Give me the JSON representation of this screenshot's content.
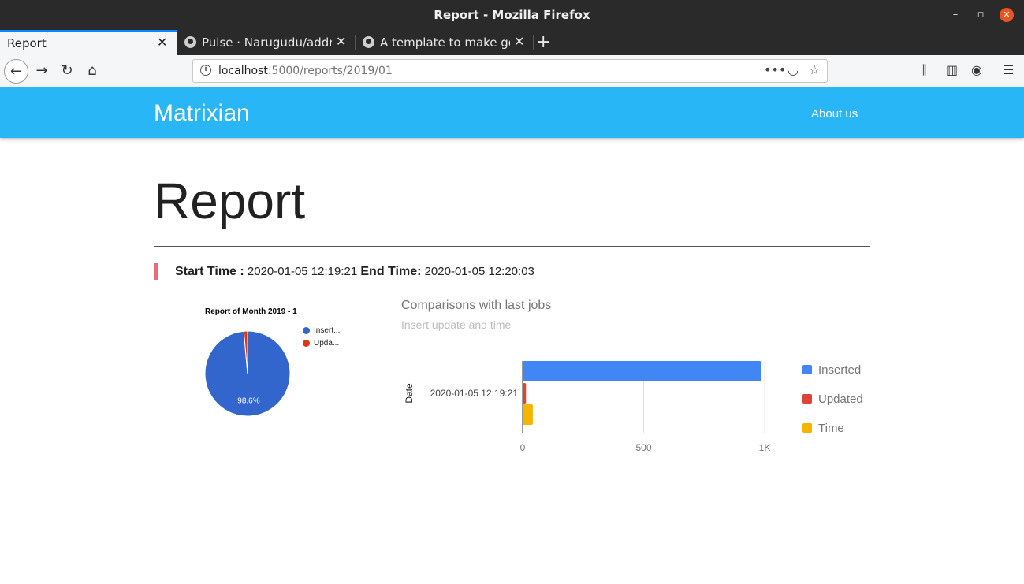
{
  "window": {
    "title": "Report - Mozilla Firefox"
  },
  "tabs": [
    {
      "label": "Report",
      "active": true
    },
    {
      "label": "Pulse · Narugudu/address",
      "icon": "github-icon"
    },
    {
      "label": "A template to make good",
      "icon": "github-icon"
    }
  ],
  "navigation": {
    "url_host": "localhost",
    "url_path": ":5000/reports/2019/01"
  },
  "app": {
    "brand": "Matrixian",
    "nav_link": "About us",
    "accent_color": "#29b6f6"
  },
  "report": {
    "title": "Report",
    "start_label": "Start Time :",
    "start_value": "2020-01-05 12:19:21",
    "end_label": "End Time:",
    "end_value": "2020-01-05 12:20:03"
  },
  "chart_data": [
    {
      "type": "pie",
      "title": "Report of Month 2019 - 1",
      "slices": [
        {
          "label": "Insert...",
          "value": 98.6,
          "color": "#3366cc",
          "data_label": "98.6%"
        },
        {
          "label": "Upda...",
          "value": 1.4,
          "color": "#dc3912"
        }
      ],
      "legend_position": "right"
    },
    {
      "type": "bar",
      "orientation": "horizontal",
      "title": "Comparisons with last jobs",
      "subtitle": "Insert update and time",
      "ylabel": "Date",
      "categories": [
        "2020-01-05 12:19:21"
      ],
      "series": [
        {
          "name": "Inserted",
          "values": [
            985
          ],
          "color": "#4285f4"
        },
        {
          "name": "Updated",
          "values": [
            14
          ],
          "color": "#db4437"
        },
        {
          "name": "Time",
          "values": [
            42
          ],
          "color": "#f4b400"
        }
      ],
      "xlim": [
        0,
        1000
      ],
      "xticks": [
        "0",
        "500",
        "1K"
      ],
      "grid": true,
      "legend_position": "right"
    }
  ]
}
